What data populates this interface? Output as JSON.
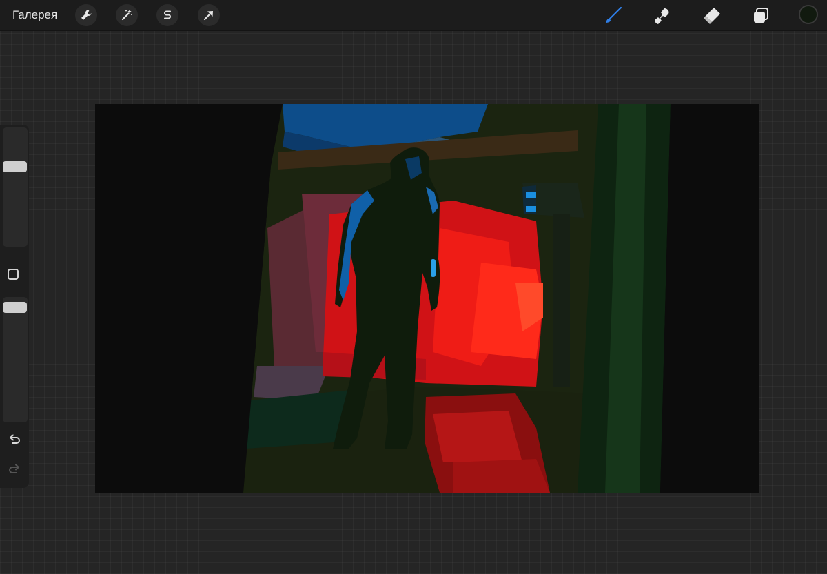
{
  "toolbar": {
    "gallery_label": "Галерея",
    "left_tools": [
      "wrench-icon",
      "magic-wand-icon",
      "selection-s-icon",
      "transform-arrow-icon"
    ],
    "right_tools": [
      "brush-icon",
      "smudge-icon",
      "eraser-icon",
      "layers-icon"
    ],
    "active_tool": "brush-icon",
    "accent_color": "#2f7ee6",
    "current_color": "#111a0f"
  },
  "sidebar": {
    "brush_size_level": 0.69,
    "brush_opacity_level": 0.96
  },
  "canvas": {
    "artwork": "painting"
  }
}
